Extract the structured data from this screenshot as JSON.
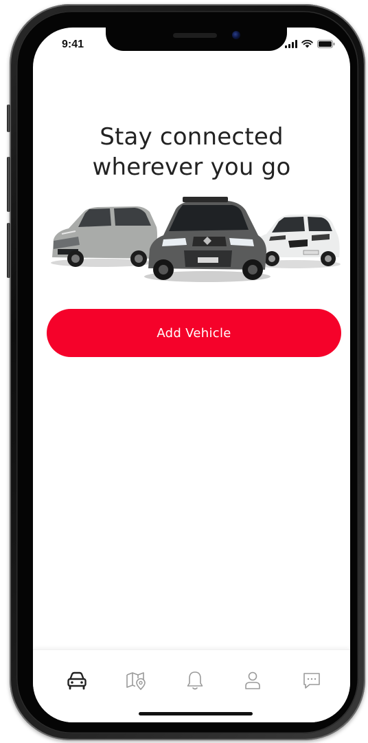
{
  "status_bar": {
    "time": "9:41"
  },
  "onboarding": {
    "headline_line1": "Stay connected",
    "headline_line2": "wherever you go",
    "add_vehicle_label": "Add Vehicle"
  },
  "bottom_nav": {
    "items": [
      {
        "icon": "car-icon",
        "active": true
      },
      {
        "icon": "map-pin-icon",
        "active": false
      },
      {
        "icon": "bell-icon",
        "active": false
      },
      {
        "icon": "user-icon",
        "active": false
      },
      {
        "icon": "chat-icon",
        "active": false
      }
    ]
  },
  "colors": {
    "accent": "#f5022a",
    "text": "#222222",
    "icon_active": "#222222",
    "icon_inactive": "#9a9a9a"
  }
}
